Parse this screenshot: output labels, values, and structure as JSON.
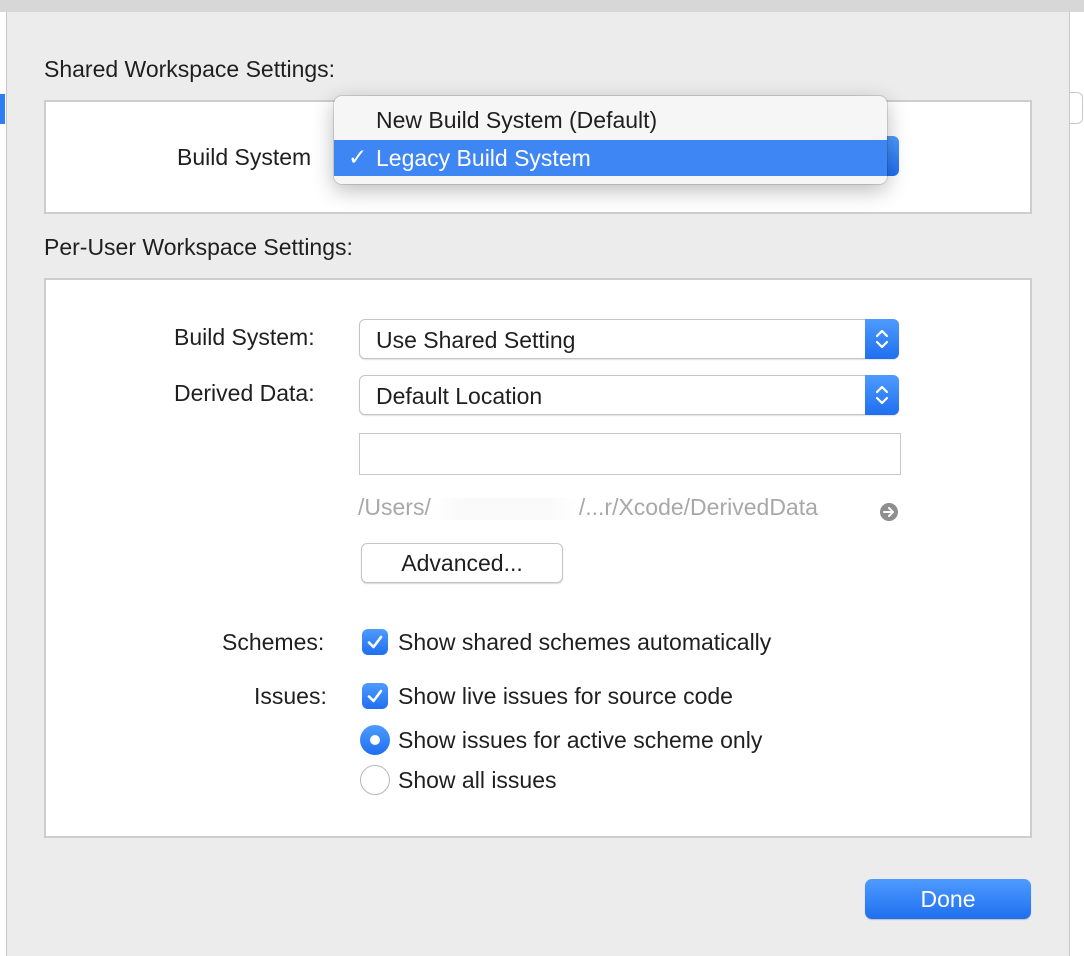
{
  "shared": {
    "title": "Shared Workspace Settings:",
    "build_system_label": "Build System",
    "menu": {
      "options": [
        {
          "label": "New Build System (Default)",
          "checked": false
        },
        {
          "label": "Legacy Build System",
          "checked": true
        }
      ],
      "checkmark": "✓"
    }
  },
  "per_user": {
    "title": "Per-User Workspace Settings:",
    "build_system_label": "Build System:",
    "build_system_value": "Use Shared Setting",
    "derived_data_label": "Derived Data:",
    "derived_data_value": "Default Location",
    "custom_path_value": "",
    "path_prefix": "/Users/",
    "path_suffix": "/...r/Xcode/DerivedData",
    "advanced_label": "Advanced...",
    "schemes_label": "Schemes:",
    "schemes_checkbox": {
      "label": "Show shared schemes automatically",
      "checked": true
    },
    "issues_label": "Issues:",
    "issues_checkbox": {
      "label": "Show live issues for source code",
      "checked": true
    },
    "issues_scope": {
      "options": [
        {
          "label": "Show issues for active scheme only",
          "selected": true
        },
        {
          "label": "Show all issues",
          "selected": false
        }
      ]
    }
  },
  "done_label": "Done",
  "accent_color": "#2f7ef6",
  "icons": [
    "chevron-updown-icon",
    "checkmark-icon",
    "reveal-arrow-icon"
  ]
}
